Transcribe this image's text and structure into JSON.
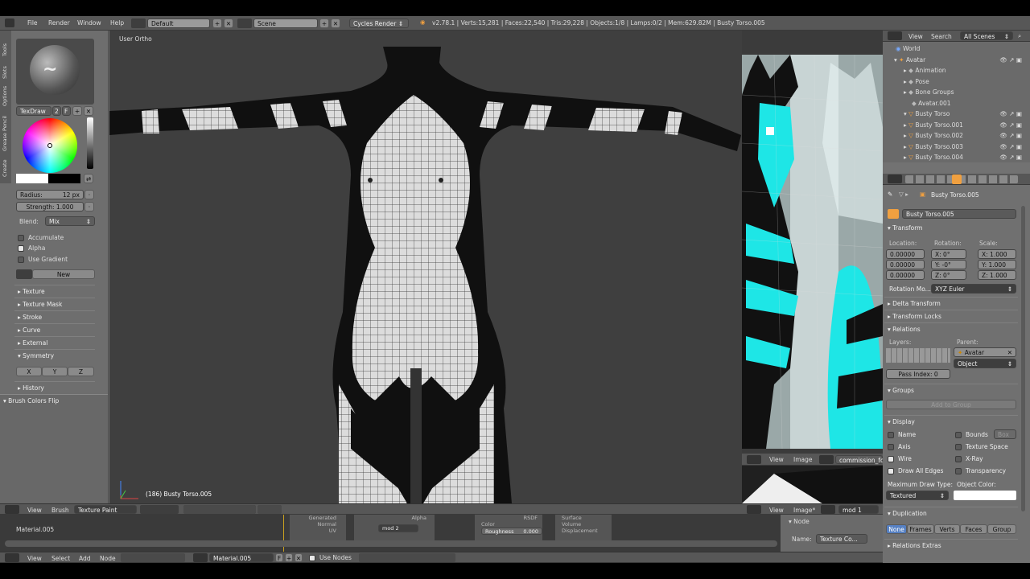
{
  "topbar": {
    "menus": [
      "File",
      "Render",
      "Window",
      "Help"
    ],
    "layout": "Default",
    "scene": "Scene",
    "engine": "Cycles Render",
    "stats": "v2.78.1 | Verts:15,281 | Faces:22,540 | Tris:29,228 | Objects:1/8 | Lamps:0/2 | Mem:629.82M | Busty Torso.005"
  },
  "toolshelf": {
    "tabs": [
      "Tools",
      "Slots",
      "Options",
      "Grease Pencil",
      "Create"
    ],
    "brush_name": "TexDraw",
    "brush_users": "2",
    "brush_flag": "F",
    "radius": "Radius:",
    "radius_val": "12 px",
    "strength": "Strength: 1.000",
    "blend_label": "Blend:",
    "blend": "Mix",
    "options": [
      {
        "label": "Accumulate",
        "on": false
      },
      {
        "label": "Alpha",
        "on": true
      },
      {
        "label": "Use Gradient",
        "on": false
      }
    ],
    "new_btn": "New",
    "sections": [
      "Texture",
      "Texture Mask",
      "Stroke",
      "Curve",
      "External",
      "Symmetry"
    ],
    "axes": [
      "X",
      "Y",
      "Z"
    ],
    "history": "History",
    "flip": "Brush Colors Flip"
  },
  "viewport": {
    "view_label": "User Ortho",
    "object_info": "(186) Busty Torso.005",
    "menus": [
      "View",
      "Brush"
    ],
    "mode": "Texture Paint"
  },
  "image_editor": {
    "menus": [
      "View",
      "Image"
    ],
    "image_name": "commission_fo",
    "bottom_menus": [
      "View",
      "Image*"
    ],
    "bottom_image": "mod 1"
  },
  "outliner": {
    "menus": [
      "View",
      "Search"
    ],
    "filter": "All Scenes",
    "items": [
      "World",
      "Avatar",
      "Animation",
      "Pose",
      "Bone Groups",
      "Avatar.001",
      "Busty Torso",
      "Busty Torso.001",
      "Busty Torso.002",
      "Busty Torso.003",
      "Busty Torso.004"
    ]
  },
  "properties": {
    "breadcrumb": "Busty Torso.005",
    "object_name": "Busty Torso.005",
    "transform": "Transform",
    "loc_label": "Location:",
    "rot_label": "Rotation:",
    "scale_label": "Scale:",
    "location": [
      "0.00000",
      "0.00000",
      "0.00000"
    ],
    "rotation": [
      "X:    0°",
      "Y:   -0°",
      "Z:    0°"
    ],
    "scale": [
      "X: 1.000",
      "Y: 1.000",
      "Z: 1.000"
    ],
    "rot_mode_label": "Rotation Mo...",
    "rot_mode": "XYZ Euler",
    "delta": "Delta Transform",
    "locks": "Transform Locks",
    "relations": "Relations",
    "layers_label": "Layers:",
    "parent_label": "Parent:",
    "parent": "Avatar",
    "parent_type": "Object",
    "pass_index": "Pass Index:",
    "pass_val": "0",
    "groups": "Groups",
    "add_group": "Add to Group",
    "display": "Display",
    "display_opts": [
      {
        "label": "Name",
        "on": false
      },
      {
        "label": "Bounds",
        "on": false
      },
      {
        "label": "Axis",
        "on": false
      },
      {
        "label": "Texture Space",
        "on": false
      },
      {
        "label": "Wire",
        "on": true
      },
      {
        "label": "X-Ray",
        "on": false
      },
      {
        "label": "Draw All Edges",
        "on": true
      },
      {
        "label": "Transparency",
        "on": false
      }
    ],
    "bounds_type": "Box",
    "max_draw_label": "Maximum Draw Type:",
    "obj_color_label": "Object Color:",
    "max_draw": "Textured",
    "duplication": "Duplication",
    "dup_opts": [
      "None",
      "Frames",
      "Verts",
      "Faces",
      "Group"
    ],
    "relations_extras": "Relations Extras"
  },
  "node_editor": {
    "material": "Material.005",
    "menus": [
      "View",
      "Select",
      "Add",
      "Node"
    ],
    "use_nodes": "Use Nodes",
    "panel_node": "Node",
    "name_label": "Name:",
    "name_val": "Texture Co...",
    "node_sockets_left": [
      "Generated",
      "Normal",
      "UV"
    ],
    "node_sockets_right": [
      "Color",
      "Roughness"
    ],
    "node_mid": "Alpha",
    "node_rsdf": "RSDF",
    "node_right": [
      "Surface",
      "Volume",
      "Displacement"
    ],
    "node_mod": "mod",
    "node_mod_count": "2",
    "roughness_val": "0.000"
  },
  "colors": {
    "accent": "#5680c2",
    "cyan": "#1ee6e6"
  }
}
